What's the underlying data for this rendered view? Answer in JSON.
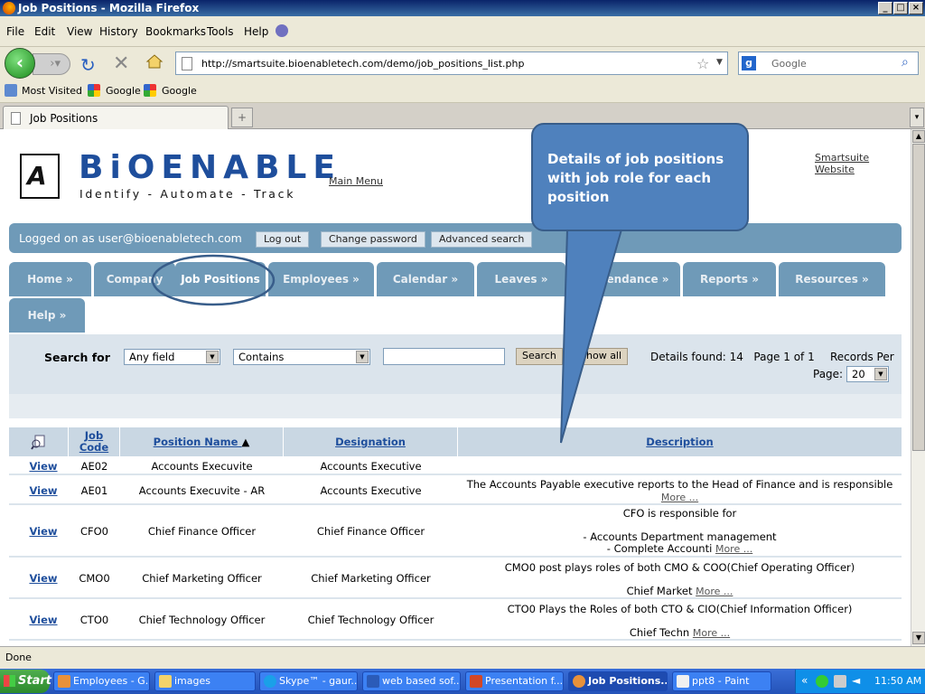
{
  "window": {
    "title": "Job Positions - Mozilla Firefox"
  },
  "menu": [
    "File",
    "Edit",
    "View",
    "History",
    "Bookmarks",
    "Tools",
    "Help"
  ],
  "nav": {
    "url": "http://smartsuite.bioenabletech.com/demo/job_positions_list.php",
    "search_placeholder": "Google"
  },
  "bookmarks": [
    "Most Visited",
    "Google",
    "Google"
  ],
  "tab": {
    "title": "Job Positions"
  },
  "page": {
    "brand": "BiOENABLE",
    "tagline": "Identify - Automate - Track",
    "main_menu": "Main Menu",
    "website_link": "Smartsuite Website",
    "logged_in": "Logged on as user@bioenabletech.com",
    "buttons": {
      "logout": "Log out",
      "change_password": "Change password",
      "advanced_search": "Advanced search"
    },
    "nav_tabs": [
      "Home »",
      "Company",
      "Job Positions",
      "Employees »",
      "Calendar »",
      "Leaves »",
      "endance »",
      "Reports »",
      "Resources »",
      "Help »"
    ],
    "search": {
      "label": "Search for",
      "field": "Any field",
      "operator": "Contains",
      "search_btn": "Search",
      "show_all_btn": "how all",
      "details_found": "Details found: 14",
      "page_of": "Page 1 of 1",
      "records_per": "Records Per",
      "page_label": "Page:",
      "page_size": "20"
    },
    "table": {
      "headers": [
        "Job Code",
        "Position Name",
        "Designation",
        "Description"
      ],
      "sort_indicator": "▲",
      "rows": [
        {
          "view": "View",
          "code": "AE02",
          "name": "Accounts Execuvite",
          "designation": "Accounts Executive",
          "desc1": "",
          "desc2": "",
          "desc3": "",
          "more": ""
        },
        {
          "view": "View",
          "code": "AE01",
          "name": "Accounts Execuvite - AR",
          "designation": "Accounts Executive",
          "desc1": "The Accounts Payable executive reports to the Head of Finance and is responsible",
          "desc2": "",
          "desc3": "",
          "more": "More ..."
        },
        {
          "view": "View",
          "code": "CFO0",
          "name": "Chief Finance Officer",
          "designation": "Chief Finance Officer",
          "desc1": "CFO is responsible for",
          "desc2": "- Accounts Department management",
          "desc3": "- Complete Accounti",
          "more": "More ..."
        },
        {
          "view": "View",
          "code": "CMO0",
          "name": "Chief Marketing Officer",
          "designation": "Chief Marketing Officer",
          "desc1": "CMO0 post plays roles of both CMO & COO(Chief Operating Officer)",
          "desc2": "",
          "desc3": "Chief Market",
          "more": "More ..."
        },
        {
          "view": "View",
          "code": "CTO0",
          "name": "Chief Technology Officer",
          "designation": "Chief Technology Officer",
          "desc1": "CTO0 Plays the Roles of both CTO & CIO(Chief Information Officer)",
          "desc2": "",
          "desc3": "Chief Techn",
          "more": "More ..."
        }
      ]
    }
  },
  "callout": {
    "text": "Details of job positions with job role for each position"
  },
  "status": {
    "text": "Done"
  },
  "taskbar": {
    "start": "Start",
    "tasks": [
      "Employees - G...",
      "images",
      "Skype™ - gaur...",
      "web based sof...",
      "Presentation f...",
      "Job Positions...",
      "ppt8 - Paint"
    ],
    "clock": "11:50 AM"
  },
  "colors": {
    "accent": "#6f9ab8",
    "callout": "#4f81bd",
    "link": "#1e4e9c"
  }
}
